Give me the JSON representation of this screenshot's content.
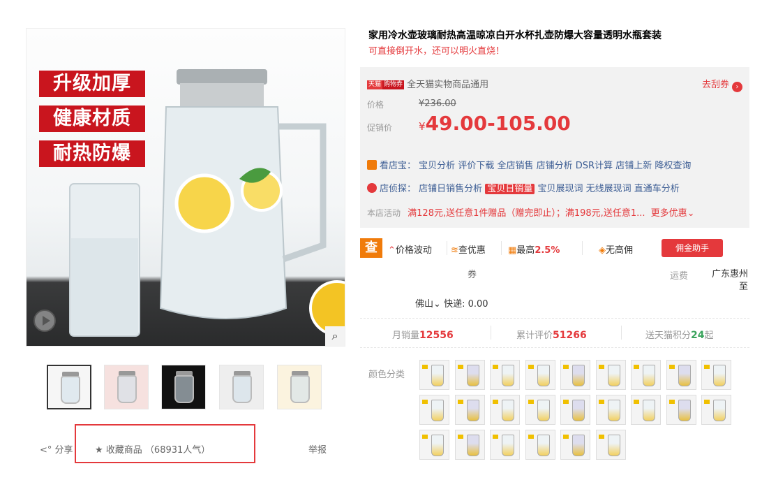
{
  "product": {
    "title": "家用冷水壶玻璃耐热高温晾凉白开水杯扎壶防爆大容量透明水瓶套装",
    "subtitle": "可直接倒开水，还可以明火直烧！"
  },
  "main_image": {
    "badges": [
      "升级加厚",
      "健康材质",
      "耐热防爆"
    ]
  },
  "actions": {
    "share": "分享",
    "favorite": "收藏商品 （68931人气）",
    "report": "举报"
  },
  "coupon": {
    "tag_tmall": "天猫",
    "tag_coupon": "购物券",
    "text": "全天猫实物商品通用",
    "link": "去刮券"
  },
  "price": {
    "label": "价格",
    "original": "¥236.00",
    "promo_label": "促销价",
    "currency": "¥",
    "promo": "49.00-105.00"
  },
  "shop_tools": {
    "kandianbao_label": "看店宝：",
    "kandianbao_links": [
      "宝贝分析",
      "评价下载",
      "全店销售",
      "店铺分析",
      "DSR计算",
      "店铺上新",
      "降权查询"
    ],
    "dianzhentan_label": "店侦探：",
    "dianzhentan_links": [
      "店铺日销售分析",
      "宝贝日销量",
      "宝贝展现词",
      "无线展现词",
      "直通车分析"
    ]
  },
  "activity": {
    "label": "本店活动",
    "text": "满128元,送任意1件赠品（赠完即止）；满198元,送任意1...",
    "more": "更多优惠"
  },
  "toolbar": {
    "search_icon": "查",
    "price_wave": "价格波动",
    "check_coupon": "查优惠",
    "coupon_suffix": "券",
    "max_rate_label": "最高",
    "max_rate_value": "2.5%",
    "no_commission": "无高佣",
    "assistant": "佣金助手"
  },
  "shipping": {
    "label": "运费",
    "origin": "广东惠州 至",
    "destination": "佛山",
    "express": "快递: 0.00"
  },
  "stats": {
    "monthly_sales_label": "月销量",
    "monthly_sales": "12556",
    "reviews_label": "累计评价",
    "reviews": "51266",
    "points_label": "送天猫积分",
    "points": "24",
    "points_suffix": "起"
  },
  "color": {
    "label": "颜色分类",
    "swatch_count": 24
  },
  "colors": {
    "accent": "#e4393c",
    "orange": "#f07b0a",
    "link": "#3c5d94"
  }
}
